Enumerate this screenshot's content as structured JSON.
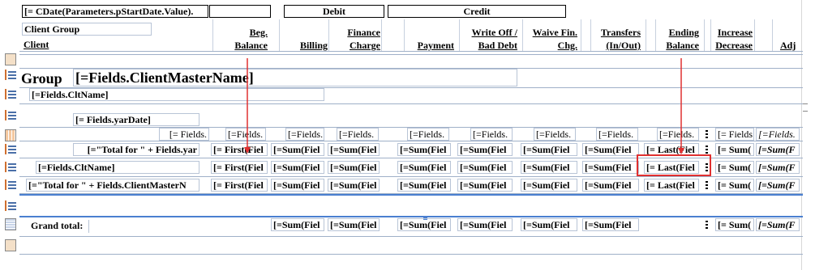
{
  "header": {
    "date_param": "[= CDate(Parameters.pStartDate.Value).",
    "debit": "Debit",
    "credit": "Credit",
    "client_group": "Client Group",
    "client": "Client",
    "columns": {
      "beg_balance": [
        "Beg.",
        "Balance"
      ],
      "billing": "Billing",
      "finance_charge": [
        "Finance",
        "Charge"
      ],
      "payment": "Payment",
      "write_off": [
        "Write Off /",
        "Bad Debt"
      ],
      "waive_fin": [
        "Waive Fin.",
        "Chg."
      ],
      "transfers": [
        "Transfers",
        "(In/Out)"
      ],
      "ending_balance": [
        "Ending",
        "Balance"
      ],
      "increase_decrease": [
        "Increase",
        "Decrease"
      ],
      "adj": "Adj"
    }
  },
  "rows": {
    "group": {
      "label": "Group",
      "value": "[=Fields.ClientMasterName]"
    },
    "clt_name": "[=Fields.CltName]",
    "yar_date": "[= Fields.yarDate]",
    "detail": {
      "first": "[= Fields.",
      "cells": [
        "[=Fields.",
        "[=Fields.",
        "[=Fields.",
        "[=Fields.",
        "[=Fields.",
        "[=Fields.",
        "[=Fields.",
        "[=Fields."
      ],
      "right": "[= Fields",
      "right_italic": "[=Fields."
    },
    "total_yar": {
      "label": "[=\"Total for \" + Fields.yar",
      "first": "[= First(Fiel",
      "sums": [
        "[=Sum(Fiel",
        "[=Sum(Fiel",
        "[=Sum(Fiel",
        "[=Sum(Fiel",
        "[=Sum(Fiel",
        "[=Sum(Fiel"
      ],
      "last": "[= Last(Fiel",
      "sum2": "[= Sum(",
      "sum2_italic": "[=Sum(F"
    },
    "total_clt": {
      "label": "[=Fields.CltName]",
      "first": "[= First(Fiel",
      "sums": [
        "[=Sum(Fiel",
        "[=Sum(Fiel",
        "[=Sum(Fiel",
        "[=Sum(Fiel",
        "[=Sum(Fiel",
        "[=Sum(Fiel"
      ],
      "last": "[= Last(Fiel",
      "sum2": "[= Sum(",
      "sum2_italic": "[=Sum(F"
    },
    "total_master": {
      "label": "[=\"Total for \" + Fields.ClientMasterN",
      "first": "[= First(Fiel",
      "sums": [
        "[=Sum(Fiel",
        "[=Sum(Fiel",
        "[=Sum(Fiel",
        "[=Sum(Fiel",
        "[=Sum(Fiel",
        "[=Sum(Fiel"
      ],
      "last": "[= Last(Fiel",
      "sum2": "[= Sum(",
      "sum2_italic": "[=Sum(F"
    },
    "grand_total": {
      "label": "Grand total:",
      "sums": [
        "[=Sum(Fiel",
        "[=Sum(Fiel",
        "[=Sum(Fiel",
        "[=Sum(Fiel",
        "[=Sum(Fiel",
        "[=Sum(Fiel"
      ],
      "sum2": "[= Sum(",
      "sum2_italic": "[=Sum(F"
    }
  },
  "colors": {
    "arrow": "#e03030",
    "highlight_box": "#e03030",
    "band_line": "#9fb0c8",
    "selected_band": "#4a7fd0"
  }
}
